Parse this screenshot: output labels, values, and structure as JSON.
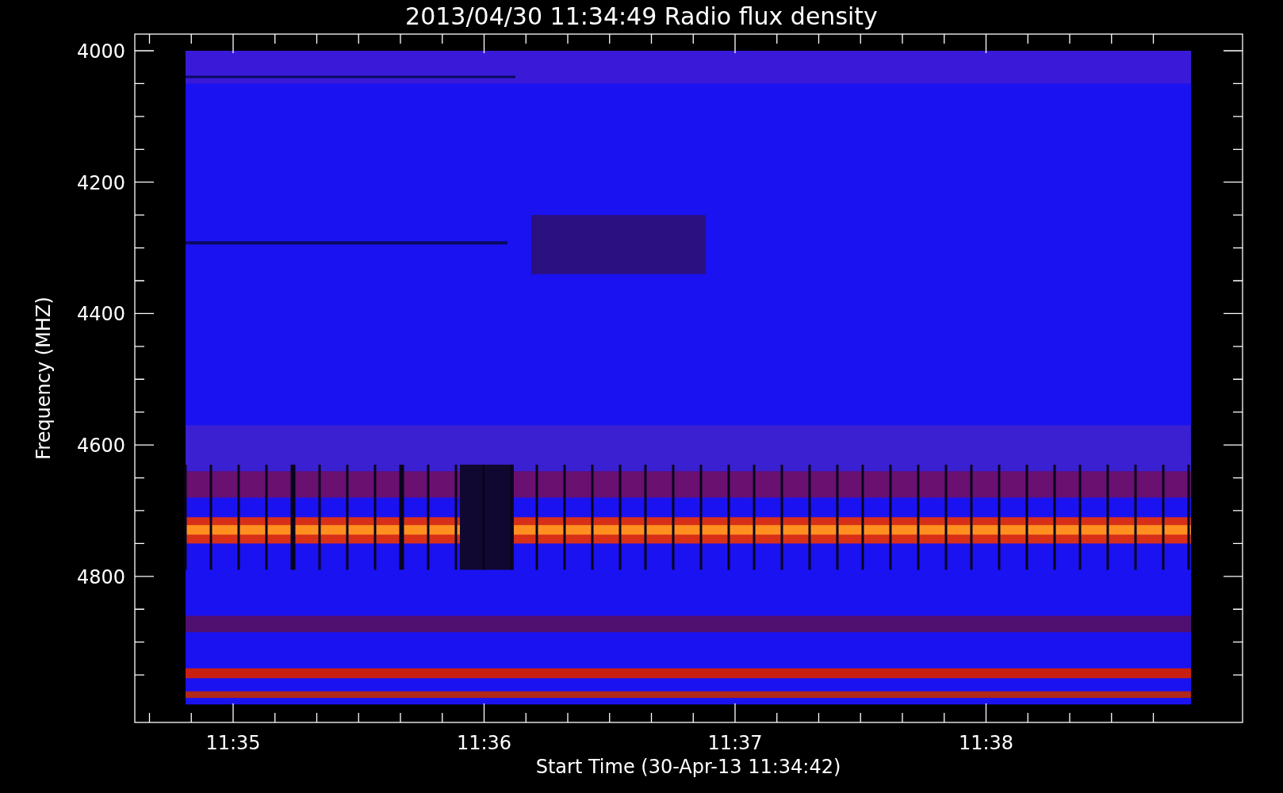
{
  "title": "2013/04/30 11:34:49 Radio flux density",
  "y_axis": {
    "label": "Frequency (MHZ)",
    "ticks": [
      "4000",
      "4200",
      "4400",
      "4600",
      "4800"
    ]
  },
  "x_axis": {
    "label": "Start Time (30-Apr-13 11:34:42)",
    "ticks": [
      "11:35",
      "11:36",
      "11:37",
      "11:38"
    ]
  }
}
